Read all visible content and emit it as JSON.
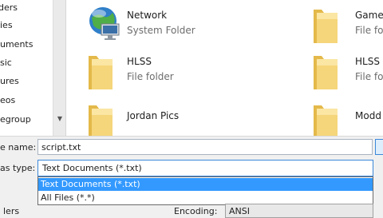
{
  "sidebar": {
    "items": [
      {
        "label": "ders"
      },
      {
        "label": "ies"
      },
      {
        "label": "uments"
      },
      {
        "label": "sic"
      },
      {
        "label": "ures"
      },
      {
        "label": "eos"
      },
      {
        "label": "egroup"
      }
    ]
  },
  "files": [
    {
      "name": "Network",
      "type": "System Folder",
      "icon": "network-icon"
    },
    {
      "name": "Game",
      "type": "File fo",
      "icon": "folder-icon"
    },
    {
      "name": "HLSS",
      "type": "File folder",
      "icon": "folder-icon"
    },
    {
      "name": "HLSS",
      "type": "File fo",
      "icon": "folder-icon"
    },
    {
      "name": "Jordan Pics",
      "type": "",
      "icon": "folder-icon"
    },
    {
      "name": "Modd",
      "type": "",
      "icon": "folder-icon"
    }
  ],
  "form": {
    "filename_label": "e name:",
    "filename_value": "script.txt",
    "type_label": "as type:",
    "type_value": "Text Documents (*.txt)",
    "type_options": [
      "Text Documents (*.txt)",
      "All Files  (*.*)"
    ],
    "encoding_label": "Encoding:",
    "encoding_value": "ANSI",
    "folders_label": "lers"
  },
  "colors": {
    "selection": "#3399ff",
    "focus_border": "#3b87d9",
    "folder_yellow": "#f5d67a"
  }
}
